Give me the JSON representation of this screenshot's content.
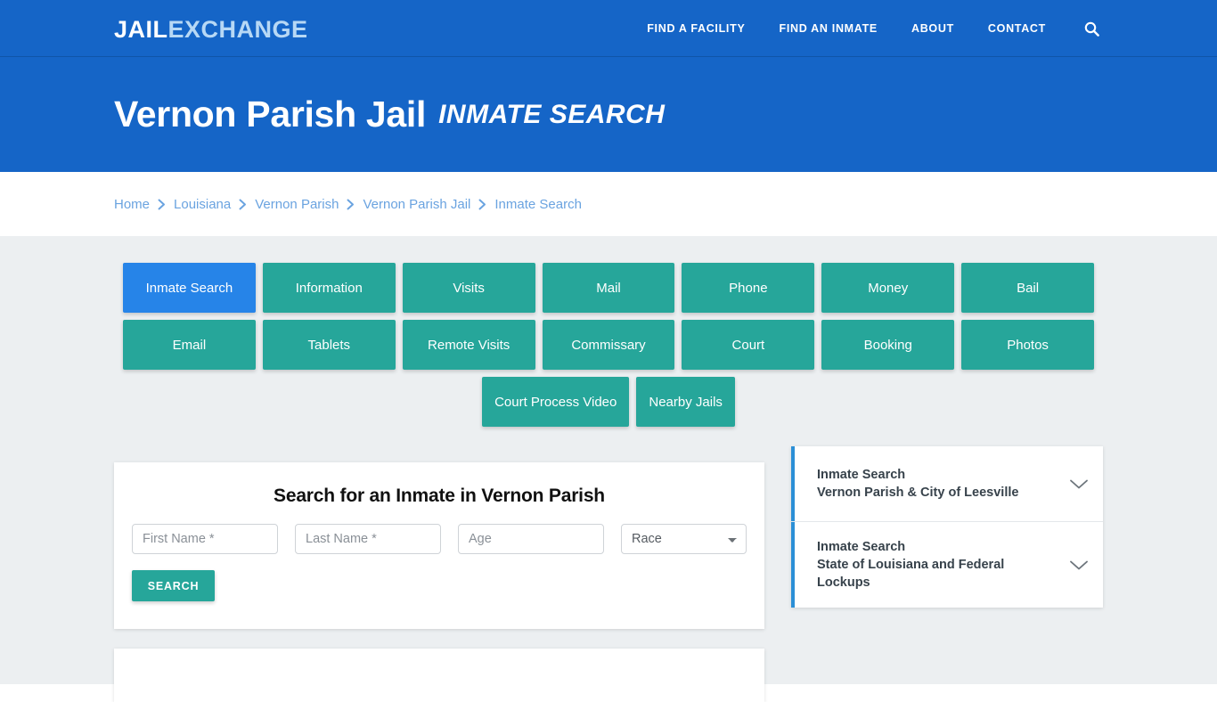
{
  "header": {
    "brand_part1": "JAIL",
    "brand_part2": "EXCHANGE",
    "nav": [
      {
        "label": "FIND A FACILITY"
      },
      {
        "label": "FIND AN INMATE"
      },
      {
        "label": "ABOUT"
      },
      {
        "label": "CONTACT"
      }
    ],
    "search_icon": "search-icon",
    "brand_color": "#1565c7"
  },
  "hero": {
    "title": "Vernon Parish Jail",
    "subtitle": "INMATE SEARCH"
  },
  "breadcrumb": {
    "items": [
      {
        "label": "Home"
      },
      {
        "label": "Louisiana"
      },
      {
        "label": "Vernon Parish"
      },
      {
        "label": "Vernon Parish Jail"
      },
      {
        "label": "Inmate Search"
      }
    ],
    "separator_icon": "chevron-right-icon",
    "link_color": "#6aa3e0"
  },
  "tabs": {
    "active_color": "#2684e8",
    "default_color": "#26a69a",
    "row1": [
      {
        "label": "Inmate Search",
        "active": true
      },
      {
        "label": "Information",
        "active": false
      },
      {
        "label": "Visits",
        "active": false
      },
      {
        "label": "Mail",
        "active": false
      },
      {
        "label": "Phone",
        "active": false
      },
      {
        "label": "Money",
        "active": false
      },
      {
        "label": "Bail",
        "active": false
      }
    ],
    "row2": [
      {
        "label": "Email",
        "active": false
      },
      {
        "label": "Tablets",
        "active": false
      },
      {
        "label": "Remote Visits",
        "active": false
      },
      {
        "label": "Commissary",
        "active": false
      },
      {
        "label": "Court",
        "active": false
      },
      {
        "label": "Booking",
        "active": false
      },
      {
        "label": "Photos",
        "active": false
      }
    ],
    "row3": [
      {
        "label": "Court Process Video",
        "active": false
      },
      {
        "label": "Nearby Jails",
        "active": false
      }
    ]
  },
  "search_form": {
    "title": "Search for an Inmate in Vernon Parish",
    "first_name_placeholder": "First Name *",
    "first_name_value": "",
    "last_name_placeholder": "Last Name *",
    "last_name_value": "",
    "age_placeholder": "Age",
    "age_value": "",
    "race_selected": "Race",
    "race_options": [
      "Race"
    ],
    "submit_label": "SEARCH",
    "submit_color": "#26a69a"
  },
  "sidebar": {
    "accent_color": "#2b8fd6",
    "items": [
      {
        "line1": "Inmate Search",
        "line2": "Vernon Parish & City of Leesville",
        "chevron": "chevron-down-icon"
      },
      {
        "line1": "Inmate Search",
        "line2": "State of Louisiana and Federal Lockups",
        "chevron": "chevron-down-icon"
      }
    ]
  }
}
